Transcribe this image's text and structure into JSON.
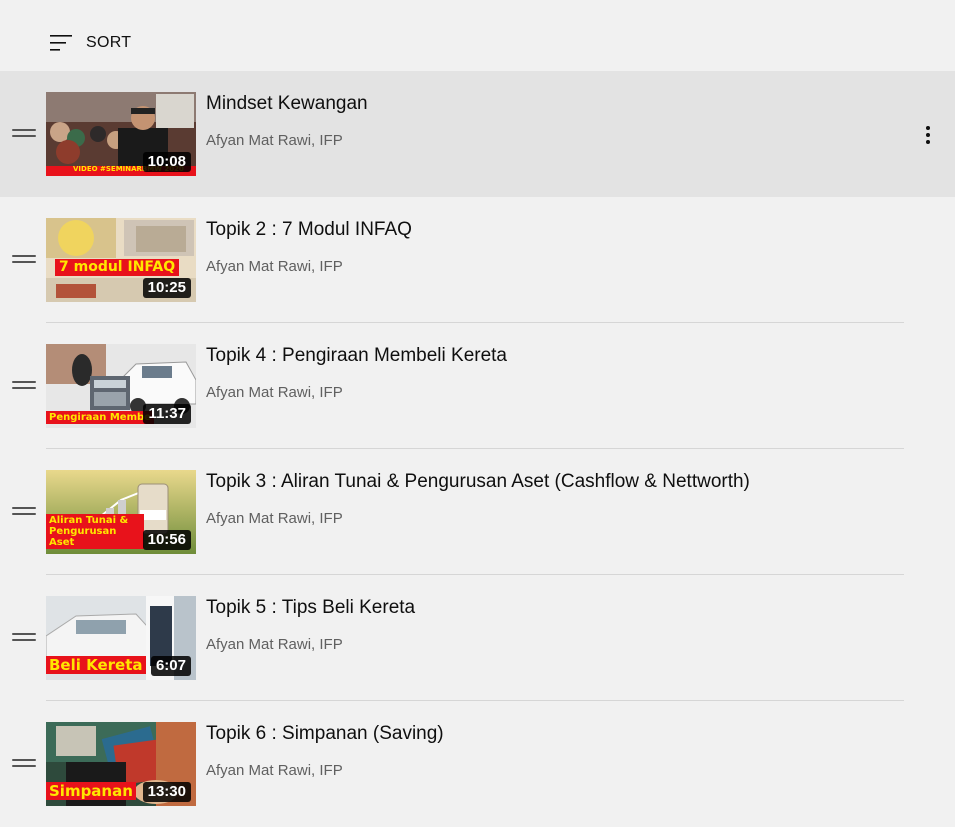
{
  "sort": {
    "label": "SORT",
    "icon": "sort-icon"
  },
  "playlist": [
    {
      "title": "Mindset Kewangan",
      "channel": "Afyan Mat Rawi, IFP",
      "duration": "10:08",
      "thumb_caption": "VIDEO #SEMINARBMW 2020",
      "active": true
    },
    {
      "title": "Topik 2 : 7 Modul INFAQ",
      "channel": "Afyan Mat Rawi, IFP",
      "duration": "10:25",
      "thumb_caption": "7 modul INFAQ",
      "active": false
    },
    {
      "title": "Topik 4 : Pengiraan Membeli Kereta",
      "channel": "Afyan Mat Rawi, IFP",
      "duration": "11:37",
      "thumb_caption": "Pengiraan Membe",
      "active": false
    },
    {
      "title": "Topik 3 : Aliran Tunai & Pengurusan Aset (Cashflow & Nettworth)",
      "channel": "Afyan Mat Rawi, IFP",
      "duration": "10:56",
      "thumb_caption": "Aliran Tunai & Pengurusan Aset",
      "active": false
    },
    {
      "title": "Topik 5 : Tips Beli Kereta",
      "channel": "Afyan Mat Rawi, IFP",
      "duration": "6:07",
      "thumb_caption": "Beli Kereta",
      "active": false
    },
    {
      "title": "Topik 6 : Simpanan (Saving)",
      "channel": "Afyan Mat Rawi, IFP",
      "duration": "13:30",
      "thumb_caption": "Simpanan",
      "active": false
    }
  ],
  "colors": {
    "background": "#f1f1f1",
    "active_row": "#e3e3e3",
    "caption_red": "#e8121b",
    "caption_yellow": "#ffe600"
  }
}
